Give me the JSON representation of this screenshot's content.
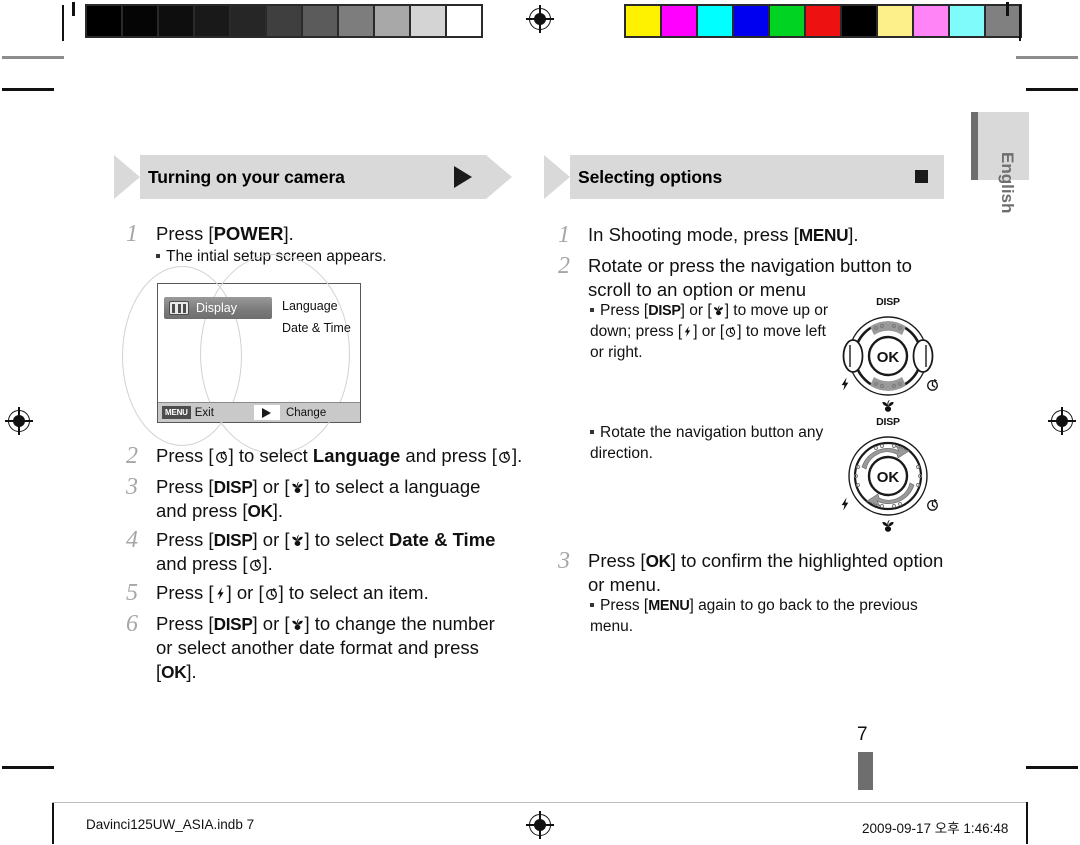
{
  "document": {
    "language_tab": "English",
    "page_number": "7",
    "footer_left": "Davinci125UW_ASIA.indb   7",
    "footer_right": "2009-09-17   오후 1:46:48"
  },
  "calibration": {
    "gray_strip": [
      "#000000",
      "#050505",
      "#0e0e0e",
      "#191919",
      "#262626",
      "#3f3f3f",
      "#5b5b5b",
      "#7d7d7d",
      "#a8a8a8",
      "#d4d4d4",
      "#ffffff"
    ],
    "color_strip": [
      "#fff200",
      "#ff00ff",
      "#00ffff",
      "#0000f0",
      "#00d321",
      "#ee1111",
      "#000000",
      "#fdf08a",
      "#ff84f5",
      "#80fbfb",
      "#808080"
    ]
  },
  "left_column": {
    "heading": "Turning on your camera",
    "heading_marker": "triangle-right",
    "steps": [
      {
        "num": "1",
        "parts": [
          {
            "t": "Press ["
          },
          {
            "t": "POWER",
            "bold": true
          },
          {
            "t": "]."
          }
        ],
        "sub": "The intial setup screen appears."
      },
      {
        "num": "2",
        "parts": [
          {
            "t": "Press ["
          },
          {
            "t": "timer-icon",
            "glyph": true
          },
          {
            "t": "] to select "
          },
          {
            "t": "Language",
            "bold": true
          },
          {
            "t": " and press ["
          },
          {
            "t": "timer-icon",
            "glyph": true
          },
          {
            "t": "]."
          }
        ]
      },
      {
        "num": "3",
        "parts": [
          {
            "t": "Press ["
          },
          {
            "t": "DISP",
            "bold": true
          },
          {
            "t": "] or ["
          },
          {
            "t": "macro-icon",
            "glyph": true
          },
          {
            "t": "] to select a language and press ["
          },
          {
            "t": "OK",
            "bold": true
          },
          {
            "t": "]."
          }
        ]
      },
      {
        "num": "4",
        "parts": [
          {
            "t": "Press ["
          },
          {
            "t": "DISP",
            "bold": true
          },
          {
            "t": "] or ["
          },
          {
            "t": "macro-icon",
            "glyph": true
          },
          {
            "t": "] to select "
          },
          {
            "t": "Date & Time",
            "bold": true
          },
          {
            "t": " and press ["
          },
          {
            "t": "timer-icon",
            "glyph": true
          },
          {
            "t": "]."
          }
        ]
      },
      {
        "num": "5",
        "parts": [
          {
            "t": "Press ["
          },
          {
            "t": "flash-icon",
            "glyph": true
          },
          {
            "t": "] or ["
          },
          {
            "t": "timer-icon",
            "glyph": true
          },
          {
            "t": "] to select an item."
          }
        ]
      },
      {
        "num": "6",
        "parts": [
          {
            "t": "Press ["
          },
          {
            "t": "DISP",
            "bold": true
          },
          {
            "t": "] or ["
          },
          {
            "t": "macro-icon",
            "glyph": true
          },
          {
            "t": "] to change the number or select another date format and press ["
          },
          {
            "t": "OK",
            "bold": true
          },
          {
            "t": "]."
          }
        ]
      }
    ]
  },
  "lcd_screen": {
    "selected_tab": "Display",
    "tab_icon": "display-icon",
    "options": [
      "Language",
      "Date & Time"
    ],
    "bottom_left_badge": "MENU",
    "bottom_left_label": "Exit",
    "bottom_right_icon": "triangle-right-icon",
    "bottom_right_label": "Change"
  },
  "right_column": {
    "heading": "Selecting options",
    "heading_marker": "square",
    "steps": [
      {
        "num": "1",
        "parts": [
          {
            "t": "In Shooting mode, press ["
          },
          {
            "t": "MENU",
            "bold": true
          },
          {
            "t": "]."
          }
        ]
      },
      {
        "num": "2",
        "parts": [
          {
            "t": "Rotate or press the navigation button to scroll to an option or menu"
          }
        ],
        "subs": [
          {
            "parts": [
              {
                "t": "Press ["
              },
              {
                "t": "DISP",
                "bold": true
              },
              {
                "t": "] or ["
              },
              {
                "t": "macro-icon",
                "glyph": true
              },
              {
                "t": "] to move up or down; press ["
              },
              {
                "t": "flash-icon",
                "glyph": true
              },
              {
                "t": "] or ["
              },
              {
                "t": "timer-icon",
                "glyph": true
              },
              {
                "t": "] to move left or right."
              }
            ]
          },
          {
            "parts": [
              {
                "t": "Rotate the navigation button any direction."
              }
            ]
          }
        ]
      },
      {
        "num": "3",
        "parts": [
          {
            "t": "Press ["
          },
          {
            "t": "OK",
            "bold": true
          },
          {
            "t": "] to confirm the highlighted option or menu."
          }
        ],
        "subs": [
          {
            "parts": [
              {
                "t": "Press ["
              },
              {
                "t": "MENU",
                "bold": true
              },
              {
                "t": "] again to go back to the previous menu."
              }
            ]
          }
        ]
      }
    ]
  },
  "nav_wheels": [
    {
      "id": "press-wheel",
      "center_label": "OK",
      "top_label": "DISP",
      "left_icon": "flash-icon",
      "right_icon": "timer-icon",
      "bottom_icon": "macro-icon",
      "mode": "press"
    },
    {
      "id": "rotate-wheel",
      "center_label": "OK",
      "top_label": "DISP",
      "left_icon": "flash-icon",
      "right_icon": "timer-icon",
      "bottom_icon": "macro-icon",
      "mode": "rotate"
    }
  ]
}
